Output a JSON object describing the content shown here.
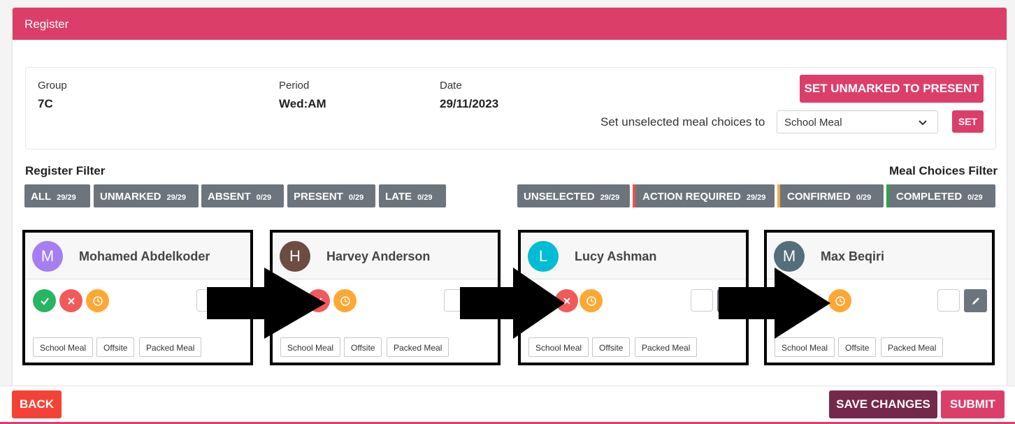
{
  "header": {
    "title": "Register"
  },
  "info": {
    "group_label": "Group",
    "group_value": "7C",
    "period_label": "Period",
    "period_value": "Wed:AM",
    "date_label": "Date",
    "date_value": "29/11/2023",
    "set_unmarked_label": "SET UNMARKED TO PRESENT",
    "meal_prompt": "Set unselected meal choices to",
    "meal_selected": "School Meal",
    "set_label": "SET"
  },
  "register_filter": {
    "title": "Register Filter",
    "chips": [
      {
        "label": "ALL",
        "count": "29/29"
      },
      {
        "label": "UNMARKED",
        "count": "29/29"
      },
      {
        "label": "ABSENT",
        "count": "0/29"
      },
      {
        "label": "PRESENT",
        "count": "0/29"
      },
      {
        "label": "LATE",
        "count": "0/29"
      }
    ]
  },
  "meal_filter": {
    "title": "Meal Choices Filter",
    "chips": [
      {
        "label": "UNSELECTED",
        "count": "29/29",
        "stripe": ""
      },
      {
        "label": "ACTION REQUIRED",
        "count": "29/29",
        "stripe": "#e9534f"
      },
      {
        "label": "CONFIRMED",
        "count": "0/29",
        "stripe": "#f0ad4e"
      },
      {
        "label": "COMPLETED",
        "count": "0/29",
        "stripe": "#28a745"
      }
    ]
  },
  "students": [
    {
      "initial": "M",
      "name": "Mohamed Abdelkoder",
      "avatar_color": "#a57ef2"
    },
    {
      "initial": "H",
      "name": "Harvey Anderson",
      "avatar_color": "#6d4c41"
    },
    {
      "initial": "L",
      "name": "Lucy Ashman",
      "avatar_color": "#00bcd4"
    },
    {
      "initial": "M",
      "name": "Max Beqiri",
      "avatar_color": "#546e7a"
    }
  ],
  "meal_options": [
    "School Meal",
    "Offsite",
    "Packed Meal"
  ],
  "status_icons": {
    "present": "check-icon",
    "absent": "x-icon",
    "late": "clock-icon"
  },
  "colors": {
    "brand": "#dc3e6a",
    "present": "#28b463",
    "absent": "#f05a5a",
    "late": "#ffa733",
    "save": "#74294a",
    "back": "#f44336"
  },
  "footer": {
    "back_label": "BACK",
    "save_label": "SAVE CHANGES",
    "submit_label": "SUBMIT"
  }
}
